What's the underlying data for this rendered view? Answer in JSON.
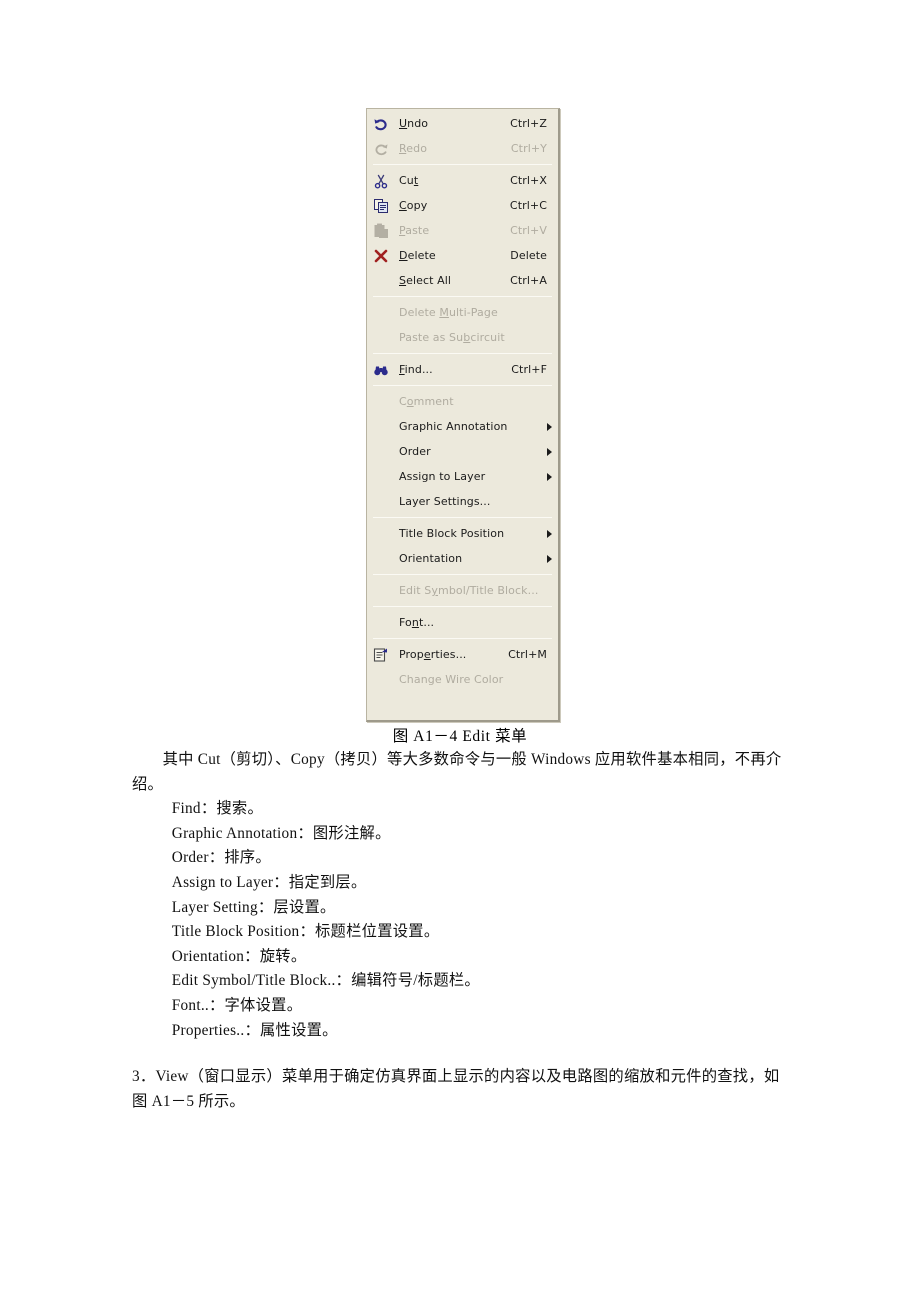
{
  "figure": {
    "caption": "图 A1－4 Edit 菜单",
    "menu_title": "Edit",
    "background_color": "#ECE9DC",
    "items": [
      {
        "label": "Undo",
        "mnemonic": "U",
        "accel": "Ctrl+Z",
        "icon": "undo-arrow-icon",
        "disabled": false,
        "submenu": false
      },
      {
        "label": "Redo",
        "mnemonic": "R",
        "accel": "Ctrl+Y",
        "icon": "redo-arrow-icon",
        "disabled": true,
        "submenu": false
      },
      {
        "separator": true
      },
      {
        "label": "Cut",
        "mnemonic": "t",
        "accel": "Ctrl+X",
        "icon": "scissors-icon",
        "disabled": false,
        "submenu": false
      },
      {
        "label": "Copy",
        "mnemonic": "C",
        "accel": "Ctrl+C",
        "icon": "copy-pages-icon",
        "disabled": false,
        "submenu": false
      },
      {
        "label": "Paste",
        "mnemonic": "P",
        "accel": "Ctrl+V",
        "icon": "clipboard-paste-icon",
        "disabled": true,
        "submenu": false
      },
      {
        "label": "Delete",
        "mnemonic": "D",
        "accel": "Delete",
        "icon": "red-x-icon",
        "disabled": false,
        "submenu": false
      },
      {
        "label": "Select All",
        "mnemonic": "S",
        "accel": "Ctrl+A",
        "icon": "",
        "disabled": false,
        "submenu": false
      },
      {
        "separator": true
      },
      {
        "label": "Delete Multi-Page",
        "mnemonic": "M",
        "accel": "",
        "icon": "",
        "disabled": true,
        "submenu": false
      },
      {
        "label": "Paste as Subcircuit",
        "mnemonic": "b",
        "accel": "",
        "icon": "",
        "disabled": true,
        "submenu": false
      },
      {
        "separator": true
      },
      {
        "label": "Find...",
        "mnemonic": "F",
        "accel": "Ctrl+F",
        "icon": "binoculars-icon",
        "disabled": false,
        "submenu": false
      },
      {
        "separator": true
      },
      {
        "label": "Comment",
        "mnemonic": "o",
        "accel": "",
        "icon": "",
        "disabled": true,
        "submenu": false
      },
      {
        "label": "Graphic Annotation",
        "mnemonic": "",
        "accel": "",
        "icon": "",
        "disabled": false,
        "submenu": true
      },
      {
        "label": "Order",
        "mnemonic": "",
        "accel": "",
        "icon": "",
        "disabled": false,
        "submenu": true
      },
      {
        "label": "Assign to Layer",
        "mnemonic": "",
        "accel": "",
        "icon": "",
        "disabled": false,
        "submenu": true
      },
      {
        "label": "Layer Settings...",
        "mnemonic": "",
        "accel": "",
        "icon": "",
        "disabled": false,
        "submenu": false
      },
      {
        "separator": true
      },
      {
        "label": "Title Block Position",
        "mnemonic": "",
        "accel": "",
        "icon": "",
        "disabled": false,
        "submenu": true
      },
      {
        "label": "Orientation",
        "mnemonic": "",
        "accel": "",
        "icon": "",
        "disabled": false,
        "submenu": true
      },
      {
        "separator": true
      },
      {
        "label": "Edit Symbol/Title Block...",
        "mnemonic": "y",
        "accel": "",
        "icon": "",
        "disabled": true,
        "submenu": false
      },
      {
        "separator": true
      },
      {
        "label": "Font...",
        "mnemonic": "n",
        "accel": "",
        "icon": "",
        "disabled": false,
        "submenu": false
      },
      {
        "separator": true
      },
      {
        "label": "Properties...",
        "mnemonic": "e",
        "accel": "Ctrl+M",
        "icon": "properties-icon",
        "disabled": false,
        "submenu": false
      },
      {
        "label": "Change Wire Color",
        "mnemonic": "",
        "accel": "",
        "icon": "",
        "disabled": true,
        "submenu": false
      }
    ]
  },
  "document": {
    "paragraphs": [
      {
        "type": "indent",
        "text": "其中 Cut（剪切）、Copy（拷贝）等大多数命令与一般 Windows 应用软件基本相同，不再介绍。"
      },
      {
        "type": "tab",
        "text": "Find：搜索。"
      },
      {
        "type": "tab",
        "text": "Graphic Annotation：图形注解。"
      },
      {
        "type": "tab",
        "text": "Order：排序。"
      },
      {
        "type": "tab",
        "text": "Assign to Layer：指定到层。"
      },
      {
        "type": "tab",
        "text": "Layer Setting：层设置。"
      },
      {
        "type": "tab",
        "text": "Title Block Position：标题栏位置设置。"
      },
      {
        "type": "tab",
        "text": "Orientation：旋转。"
      },
      {
        "type": "tab",
        "text": "Edit Symbol/Title Block..：编辑符号/标题栏。"
      },
      {
        "type": "tab",
        "text": "Font..：字体设置。"
      },
      {
        "type": "tab",
        "text": "Properties..：属性设置。"
      },
      {
        "type": "gap",
        "text": ""
      },
      {
        "type": "plain",
        "text": "3．View（窗口显示）菜单用于确定仿真界面上显示的内容以及电路图的缩放和元件的查找，如图 A1－5 所示。"
      }
    ]
  }
}
